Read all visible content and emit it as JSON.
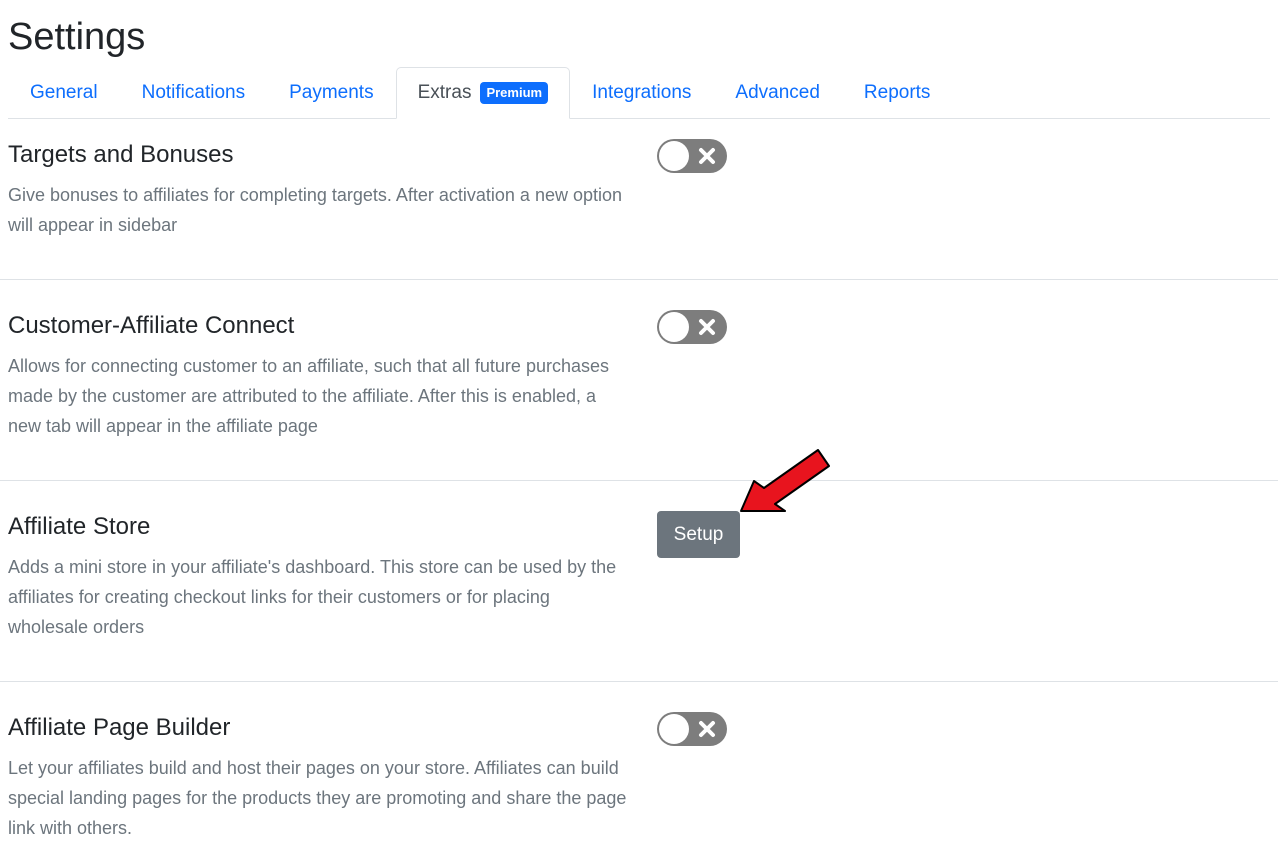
{
  "page": {
    "title": "Settings"
  },
  "tabs": [
    {
      "label": "General",
      "active": false
    },
    {
      "label": "Notifications",
      "active": false
    },
    {
      "label": "Payments",
      "active": false
    },
    {
      "label": "Extras",
      "active": true,
      "badge": "Premium"
    },
    {
      "label": "Integrations",
      "active": false
    },
    {
      "label": "Advanced",
      "active": false
    },
    {
      "label": "Reports",
      "active": false
    }
  ],
  "sections": [
    {
      "title": "Targets and Bonuses",
      "description": "Give bonuses to affiliates for completing targets. After activation a new option will appear in sidebar",
      "control": "toggle",
      "enabled": false
    },
    {
      "title": "Customer-Affiliate Connect",
      "description": "Allows for connecting customer to an affiliate, such that all future purchases made by the customer are attributed to the affiliate. After this is enabled, a new tab will appear in the affiliate page",
      "control": "toggle",
      "enabled": false
    },
    {
      "title": "Affiliate Store",
      "description": "Adds a mini store in your affiliate's dashboard. This store can be used by the affiliates for creating checkout links for their customers or for placing wholesale orders",
      "control": "button",
      "button_label": "Setup"
    },
    {
      "title": "Affiliate Page Builder",
      "description": "Let your affiliates build and host their pages on your store. Affiliates can build special landing pages for the products they are promoting and share the page link with others.",
      "control": "toggle",
      "enabled": false
    }
  ],
  "colors": {
    "link": "#0d6efd",
    "badge": "#0d6efd",
    "toggle_off": "#7d7d7d",
    "button": "#6c757d",
    "arrow": "#e8141e",
    "muted_text": "#6c757d"
  },
  "icons": {
    "toggle_off": "close-x-icon",
    "annotation": "red-arrow-icon"
  }
}
